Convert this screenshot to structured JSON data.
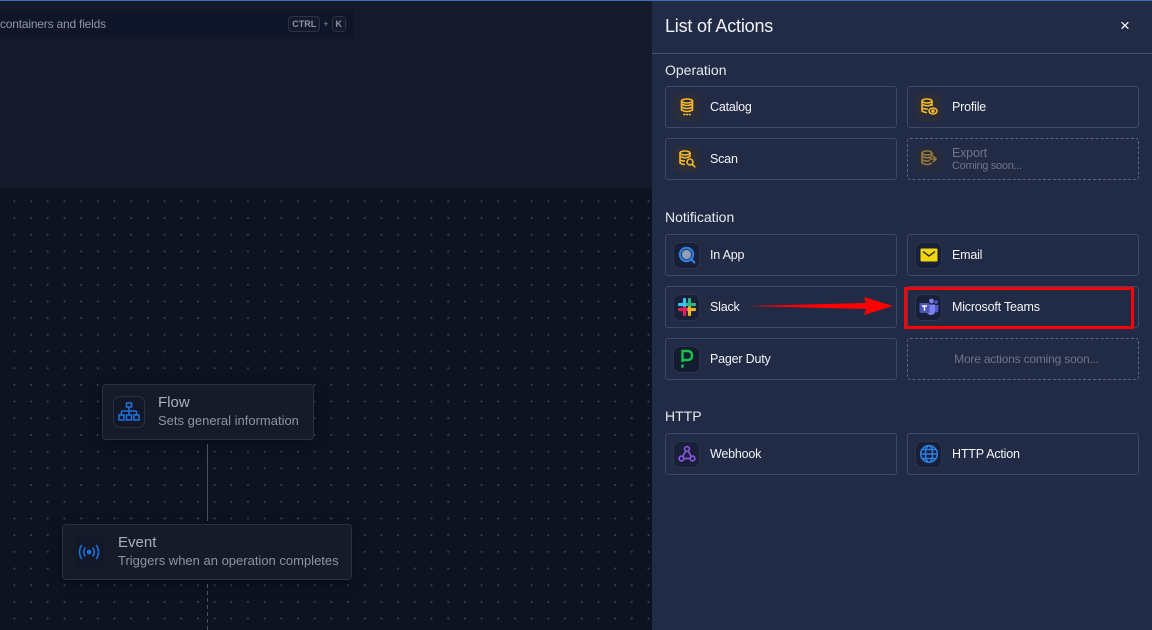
{
  "canvas": {
    "search": {
      "placeholder_visible": "containers and fields",
      "shortcut": {
        "key1": "CTRL",
        "plus": "+",
        "key2": "K"
      }
    },
    "nodes": [
      {
        "id": "flow",
        "title": "Flow",
        "subtitle": "Sets general information",
        "icon": "sitemap-icon"
      },
      {
        "id": "event",
        "title": "Event",
        "subtitle": "Triggers when an operation completes",
        "icon": "broadcast-icon"
      }
    ]
  },
  "panel": {
    "title": "List of Actions",
    "close_label": "×",
    "sections": [
      {
        "title": "Operation",
        "items": [
          {
            "label": "Catalog",
            "icon": "database-icon",
            "enabled": true
          },
          {
            "label": "Profile",
            "icon": "database-eye-icon",
            "enabled": true
          },
          {
            "label": "Scan",
            "icon": "database-search-icon",
            "enabled": true
          },
          {
            "label": "Export",
            "sub": "Coming soon...",
            "icon": "database-export-icon",
            "enabled": false
          }
        ]
      },
      {
        "title": "Notification",
        "items": [
          {
            "label": "In App",
            "icon": "in-app-icon",
            "enabled": true
          },
          {
            "label": "Email",
            "icon": "email-icon",
            "enabled": true
          },
          {
            "label": "Slack",
            "icon": "slack-icon",
            "enabled": true
          },
          {
            "label": "Microsoft Teams",
            "icon": "teams-icon",
            "enabled": true,
            "highlighted": true
          },
          {
            "label": "Pager Duty",
            "icon": "pagerduty-icon",
            "enabled": true
          },
          {
            "label": "More actions coming soon...",
            "enabled": false
          }
        ]
      },
      {
        "title": "HTTP",
        "items": [
          {
            "label": "Webhook",
            "icon": "webhook-icon",
            "enabled": true
          },
          {
            "label": "HTTP Action",
            "icon": "globe-icon",
            "enabled": true
          }
        ]
      }
    ]
  },
  "annotation": {
    "color": "#ff0000",
    "from": "Slack",
    "to": "Microsoft Teams"
  },
  "colors": {
    "panel_bg": "#222b46",
    "canvas_bg": "#0e1322",
    "operation_icon": "#f5b82e",
    "accent_blue": "#2f7de1"
  }
}
